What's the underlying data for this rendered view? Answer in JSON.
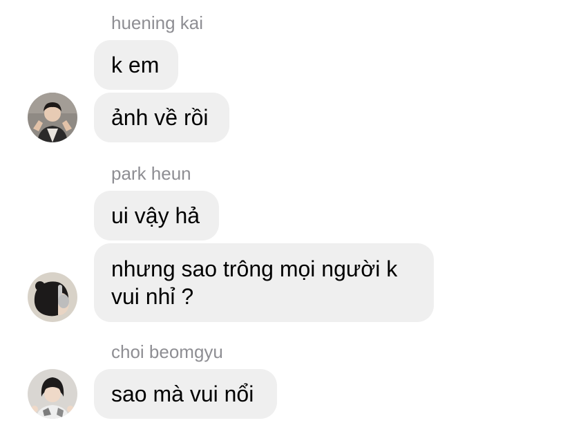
{
  "thread": {
    "groups": [
      {
        "sender": "huening kai",
        "avatar_icon": "person-avatar-icon",
        "messages": [
          "k em",
          "ảnh về rồi"
        ]
      },
      {
        "sender": "park heun",
        "avatar_icon": "person-avatar-icon",
        "messages": [
          "ui vậy hả",
          "nhưng sao trông mọi người k vui nhỉ ?"
        ]
      },
      {
        "sender": "choi beomgyu",
        "avatar_icon": "person-avatar-icon",
        "messages": [
          "sao mà vui nổi"
        ]
      }
    ]
  },
  "colors": {
    "bubble_bg": "#efefef",
    "sender_text": "#8e8e93",
    "message_text": "#000000",
    "background": "#ffffff"
  }
}
